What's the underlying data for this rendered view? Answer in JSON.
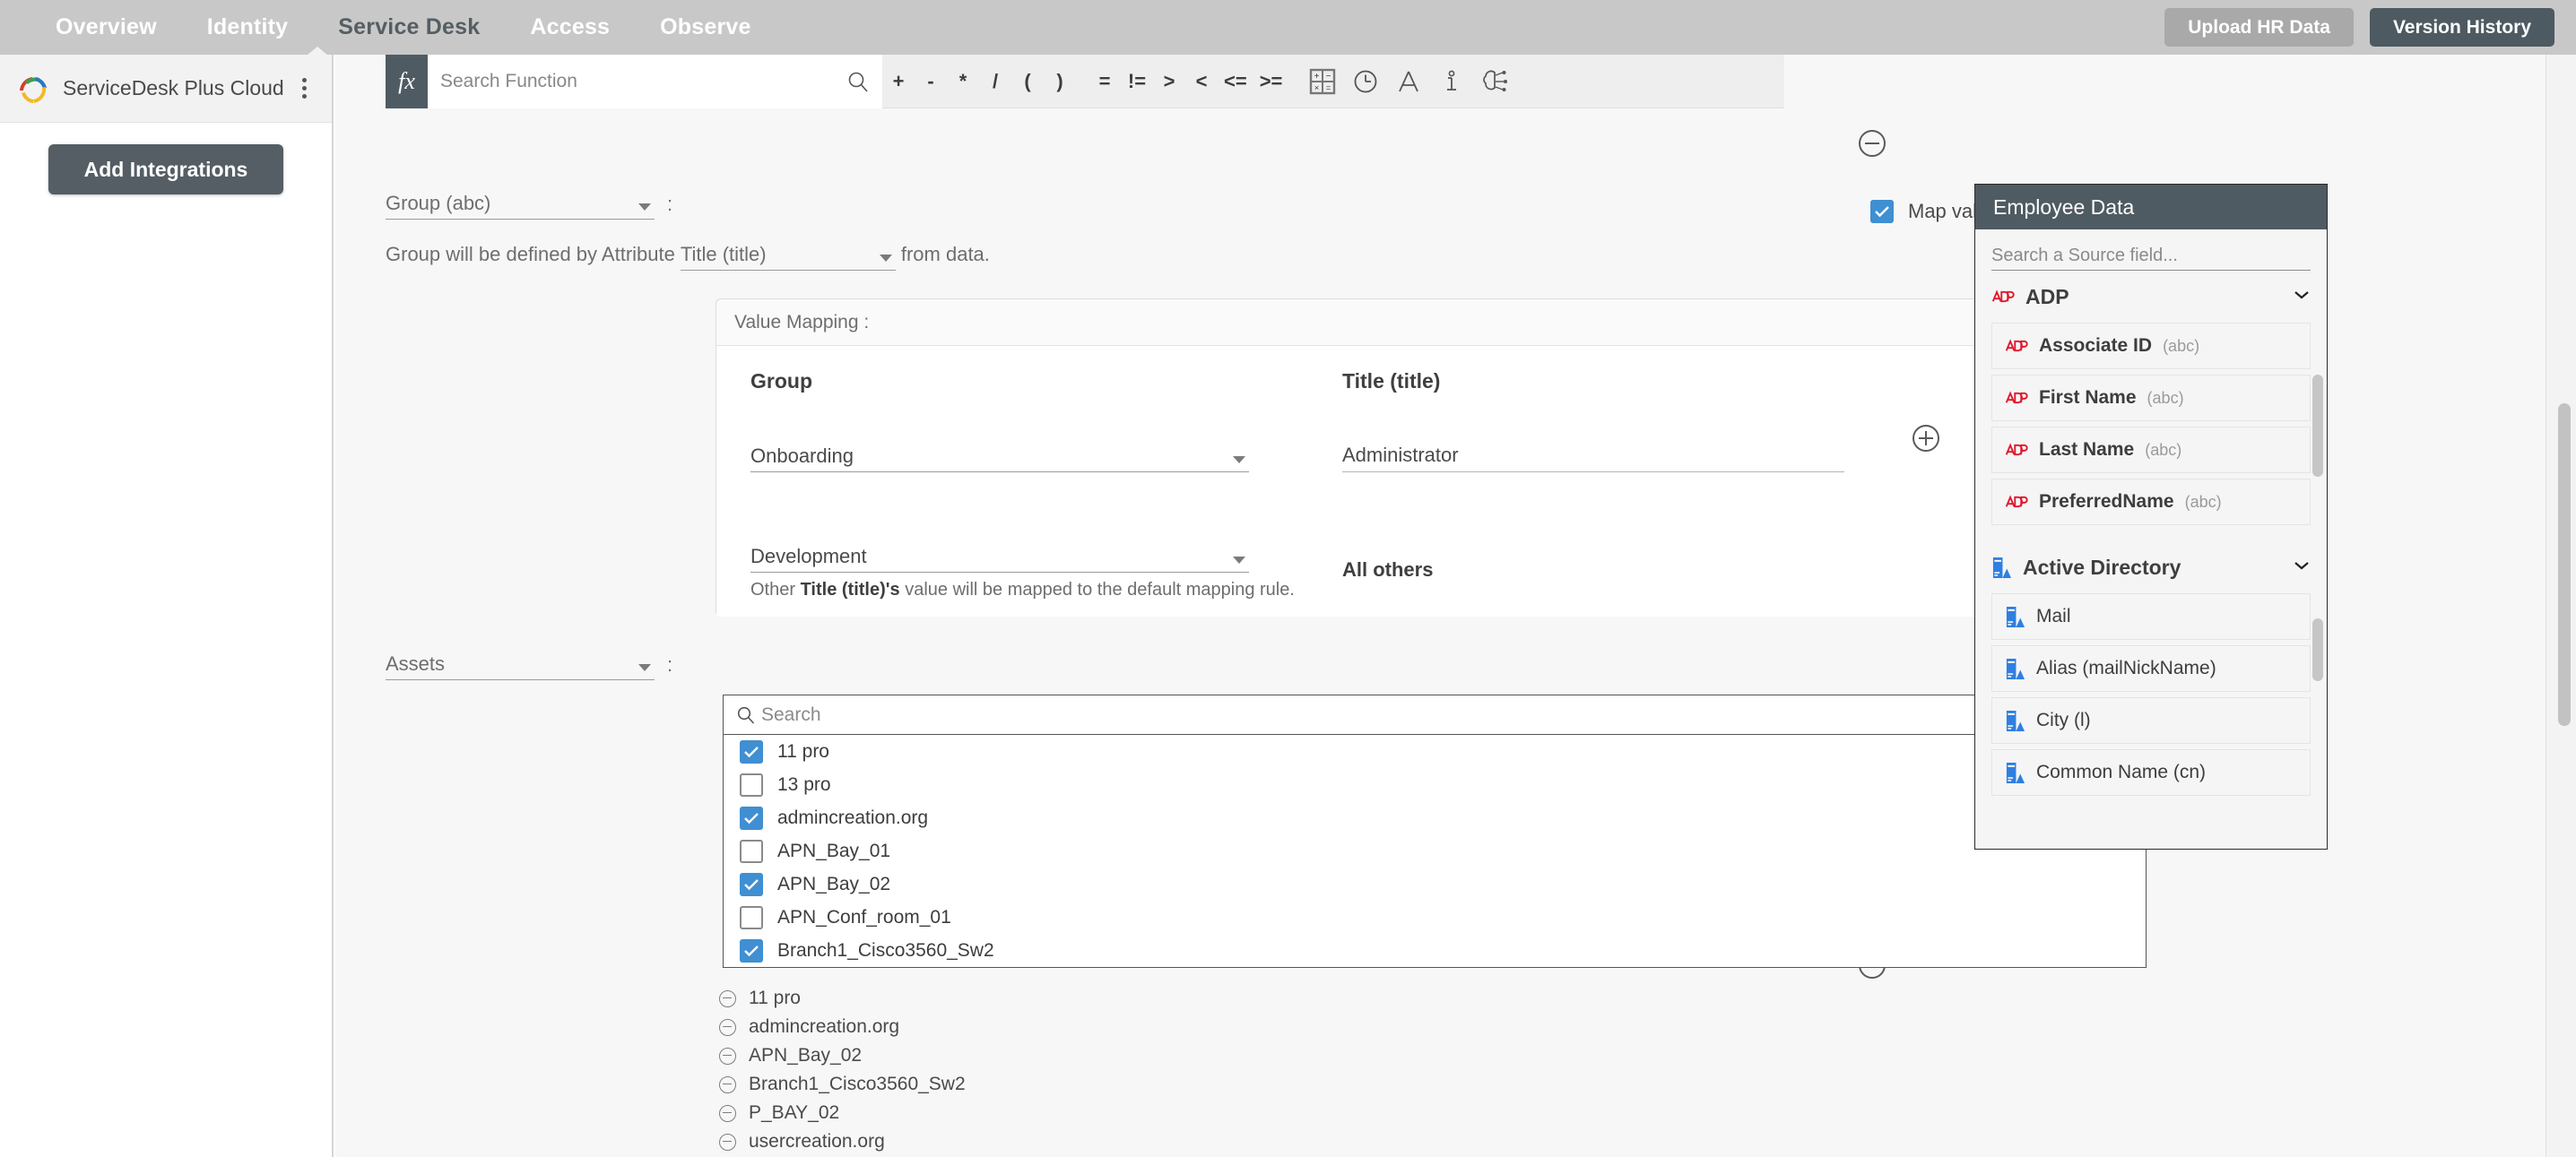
{
  "topnav": {
    "items": [
      {
        "label": "Overview",
        "active": false
      },
      {
        "label": "Identity",
        "active": false
      },
      {
        "label": "Service Desk",
        "active": true
      },
      {
        "label": "Access",
        "active": false
      },
      {
        "label": "Observe",
        "active": false
      }
    ],
    "upload_button": "Upload HR Data",
    "version_button": "Version History",
    "active_color": "#555e63",
    "bar_color": "#c8c8c8",
    "primary_button_color": "#4d5a61"
  },
  "sidebar": {
    "app_title": "ServiceDesk Plus Cloud",
    "kebab": "more-options",
    "add_integrations": "Add Integrations"
  },
  "function_toolbar": {
    "fx_label": "fx",
    "search_placeholder": "Search Function",
    "operators": [
      "+",
      "-",
      "*",
      "/",
      "(",
      ")",
      "=",
      "!=",
      ">",
      "<",
      "<=",
      ">="
    ],
    "icons": [
      "calculator-icon",
      "clock-icon",
      "text-icon",
      "info-icon",
      "ai-brain-icon"
    ]
  },
  "group_section": {
    "field_label": "Group (abc)",
    "colon": ":",
    "attribute_prefix": "Group will be defined by Attribute",
    "attribute_value": "Title (title)",
    "attribute_suffix": "from data.",
    "map_value_label": "Map value",
    "map_value_checked": true,
    "checkbox_color": "#3f8fd2"
  },
  "value_mapping": {
    "header": "Value Mapping :",
    "collapse_icon": "chevron-up-icon",
    "col_left": "Group",
    "col_right": "Title (title)",
    "rows": [
      {
        "group": "Onboarding",
        "value": "Administrator",
        "value_is_input": true
      },
      {
        "group": "Development",
        "value": "All others",
        "value_is_input": false
      }
    ],
    "add_icon": "plus-circle-icon",
    "note_prefix": "Other ",
    "note_bold": "Title (title)'s",
    "note_suffix": " value will be mapped to the default mapping rule."
  },
  "assets_section": {
    "field_label": "Assets",
    "colon": ":",
    "grid_icon": "grid-view-icon",
    "search_placeholder": "Search",
    "options": [
      {
        "label": "11 pro",
        "checked": true
      },
      {
        "label": "13 pro",
        "checked": false
      },
      {
        "label": "admincreation.org",
        "checked": true
      },
      {
        "label": "APN_Bay_01",
        "checked": false
      },
      {
        "label": "APN_Bay_02",
        "checked": true
      },
      {
        "label": "APN_Conf_room_01",
        "checked": false
      },
      {
        "label": "Branch1_Cisco3560_Sw2",
        "checked": true
      }
    ]
  },
  "selected_assets": [
    "11 pro",
    "admincreation.org",
    "APN_Bay_02",
    "Branch1_Cisco3560_Sw2",
    "P_BAY_02",
    "usercreation.org"
  ],
  "employee_data": {
    "title": "Employee Data",
    "search_placeholder": "Search a Source field...",
    "groups": [
      {
        "name": "ADP",
        "icon": "adp-icon",
        "chevron": "chevron-down-icon",
        "fields": [
          {
            "name": "Associate ID",
            "type": "(abc)"
          },
          {
            "name": "First Name",
            "type": "(abc)"
          },
          {
            "name": "Last Name",
            "type": "(abc)"
          },
          {
            "name": "PreferredName",
            "type": "(abc)"
          }
        ]
      },
      {
        "name": "Active Directory",
        "icon": "active-directory-icon",
        "chevron": "chevron-down-icon",
        "fields": [
          {
            "name": "Mail",
            "type": ""
          },
          {
            "name": "Alias (mailNickName)",
            "type": ""
          },
          {
            "name": "City (l)",
            "type": ""
          },
          {
            "name": "Common Name (cn)",
            "type": ""
          }
        ]
      }
    ]
  },
  "collapse_buttons": [
    "minus-circle-icon",
    "minus-circle-icon",
    "minus-circle-icon"
  ]
}
